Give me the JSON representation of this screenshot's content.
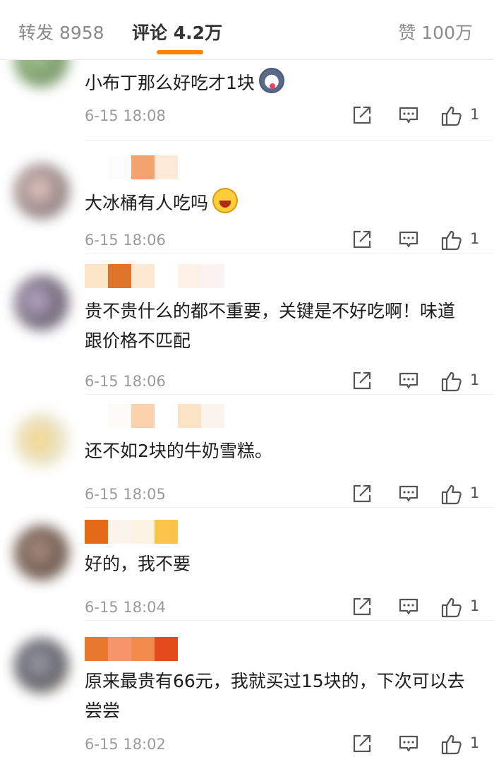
{
  "tabs": {
    "forward": "转发 8958",
    "comments": "评论 4.2万",
    "likes": "赞 100万"
  },
  "colors": {
    "accent": "#ff8200",
    "time": "#9b9b9b"
  },
  "icons": [
    "share-icon",
    "reply-icon",
    "thumbs-up-icon"
  ],
  "comments": [
    {
      "text": "小布丁那么好吃才1块",
      "emoji": "husky-emoji",
      "time": "6-15 18:08",
      "likes": "1"
    },
    {
      "text": "大冰桶有人吃吗",
      "emoji": "laughing-emoji",
      "time": "6-15 18:06",
      "likes": "1"
    },
    {
      "text": "贵不贵什么的都不重要，关键是不好吃啊！味道跟价格不匹配",
      "time": "6-15 18:06",
      "likes": "1"
    },
    {
      "text": "还不如2块的牛奶雪糕。",
      "time": "6-15 18:05",
      "likes": "1"
    },
    {
      "text": "好的，我不要",
      "time": "6-15 18:04",
      "likes": "1"
    },
    {
      "text": "原来最贵有66元，我就买过15块的，下次可以去尝尝",
      "time": "6-15 18:02",
      "likes": "1"
    }
  ]
}
